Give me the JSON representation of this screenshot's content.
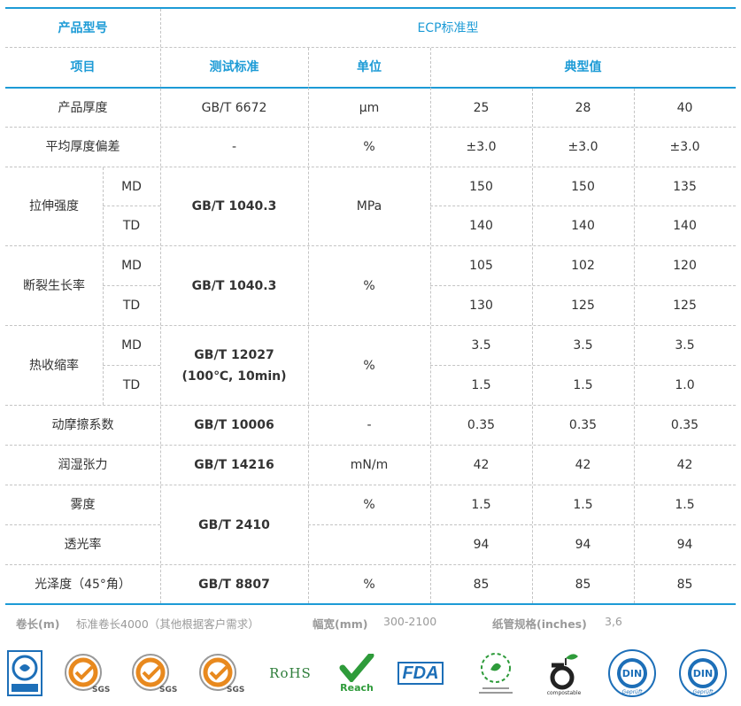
{
  "header": {
    "model_label": "产品型号",
    "model_value": "ECP标准型",
    "col_item": "项目",
    "col_standard": "测试标准",
    "col_unit": "单位",
    "col_typical": "典型值"
  },
  "rows": {
    "thickness": {
      "name": "产品厚度",
      "std": "GB/T 6672",
      "unit": "μm",
      "v": [
        "25",
        "28",
        "40"
      ]
    },
    "deviation": {
      "name": "平均厚度偏差",
      "std": "-",
      "unit": "%",
      "v": [
        "±3.0",
        "±3.0",
        "±3.0"
      ]
    },
    "tensile": {
      "name": "拉伸强度",
      "std": "GB/T 1040.3",
      "unit": "MPa",
      "md_label": "MD",
      "td_label": "TD",
      "md": [
        "150",
        "150",
        "135"
      ],
      "td": [
        "140",
        "140",
        "140"
      ]
    },
    "elongation": {
      "name": "断裂生长率",
      "std": "GB/T 1040.3",
      "unit": "%",
      "md_label": "MD",
      "td_label": "TD",
      "md": [
        "105",
        "102",
        "120"
      ],
      "td": [
        "130",
        "125",
        "125"
      ]
    },
    "shrink": {
      "name": "热收缩率",
      "std1": "GB/T 12027",
      "std2": "(100℃, 10min)",
      "unit": "%",
      "md_label": "MD",
      "td_label": "TD",
      "md": [
        "3.5",
        "3.5",
        "3.5"
      ],
      "td": [
        "1.5",
        "1.5",
        "1.0"
      ]
    },
    "friction": {
      "name": "动摩擦系数",
      "std": "GB/T 10006",
      "unit": "-",
      "v": [
        "0.35",
        "0.35",
        "0.35"
      ]
    },
    "wetting": {
      "name": "润湿张力",
      "std": "GB/T 14216",
      "unit": "mN/m",
      "v": [
        "42",
        "42",
        "42"
      ]
    },
    "haze": {
      "name": "雾度",
      "std": "GB/T 2410",
      "unit": "%",
      "v": [
        "1.5",
        "1.5",
        "1.5"
      ]
    },
    "transmittance": {
      "name": "透光率",
      "unit": "",
      "v": [
        "94",
        "94",
        "94"
      ]
    },
    "gloss": {
      "name": "光泽度（45°角）",
      "std": "GB/T 8807",
      "unit": "%",
      "v": [
        "85",
        "85",
        "85"
      ]
    }
  },
  "footer": {
    "roll_label": "卷长(m)",
    "roll_value": "标准卷长4000（其他根据客户需求）",
    "width_label": "幅宽(mm)",
    "width_value": "300-2100",
    "core_label": "纸管规格(inches)",
    "core_value": "3,6"
  },
  "logos": {
    "sgs_text": "SGS",
    "rohs": "RoHS",
    "reach": "Reach",
    "fda": "FDA",
    "din": "DIN",
    "din_sub": "Geprüft",
    "compostable": "compostable",
    "green": "#2e9b3a",
    "blue": "#1d6fb8",
    "orange": "#e8891e"
  }
}
